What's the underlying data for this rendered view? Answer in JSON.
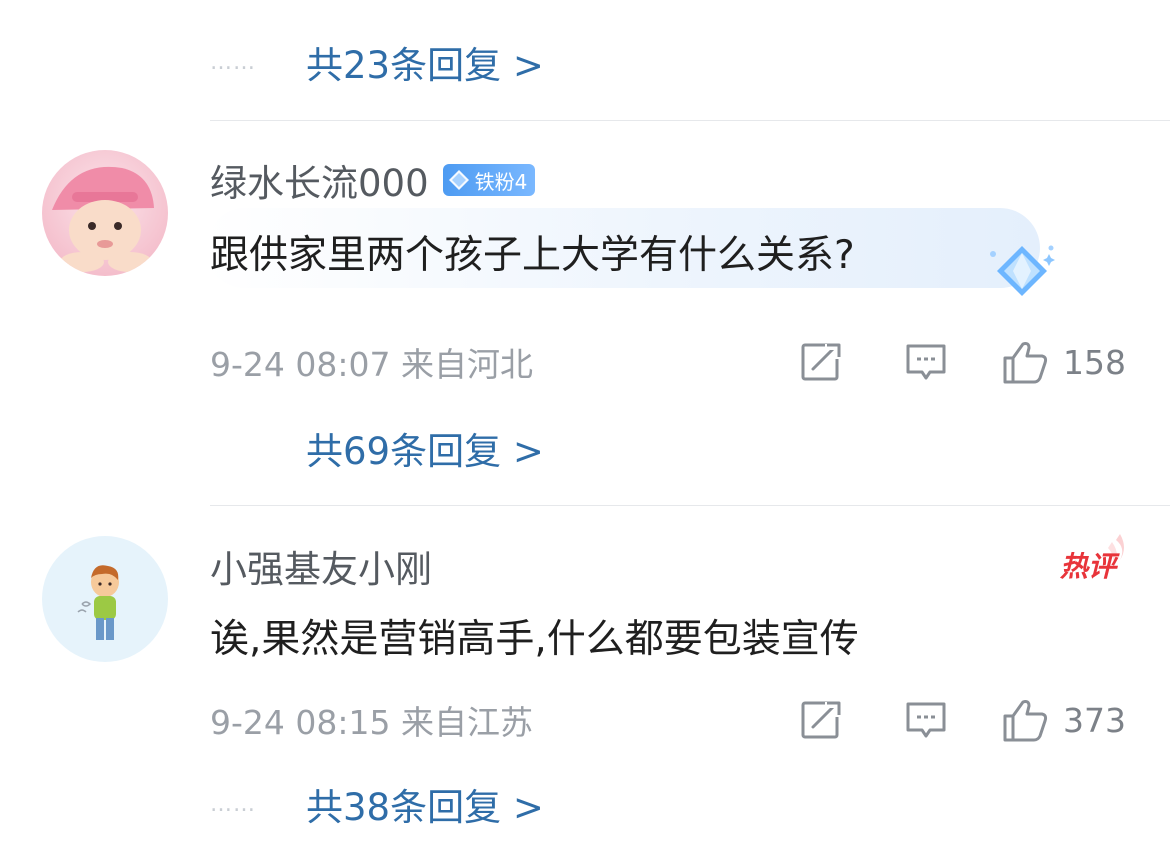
{
  "replies": [
    {
      "dots": "……",
      "label": "共23条回复 >"
    },
    {
      "dots": "",
      "label": "共69条回复 >"
    },
    {
      "dots": "……",
      "label": "共38条回复 >"
    }
  ],
  "comments": [
    {
      "username": "绿水长流000",
      "badge": "铁粉4",
      "text": "跟供家里两个孩子上大学有什么关系?",
      "meta": "9-24 08:07  来自河北",
      "likes": "158"
    },
    {
      "username": "小强基友小刚",
      "badge": "热评",
      "text": "诶,果然是营销高手,什么都要包装宣传",
      "meta": "9-24 08:15  来自江苏",
      "likes": "373"
    }
  ],
  "icons": {
    "share": "share-icon",
    "comment": "comment-icon",
    "like": "like-icon",
    "fan_badge": "diamond-icon"
  },
  "colors": {
    "link": "#2f6da8",
    "meta": "#9a9fa6",
    "hot": "#e8343a",
    "fan_badge": "#4d9bf2"
  }
}
